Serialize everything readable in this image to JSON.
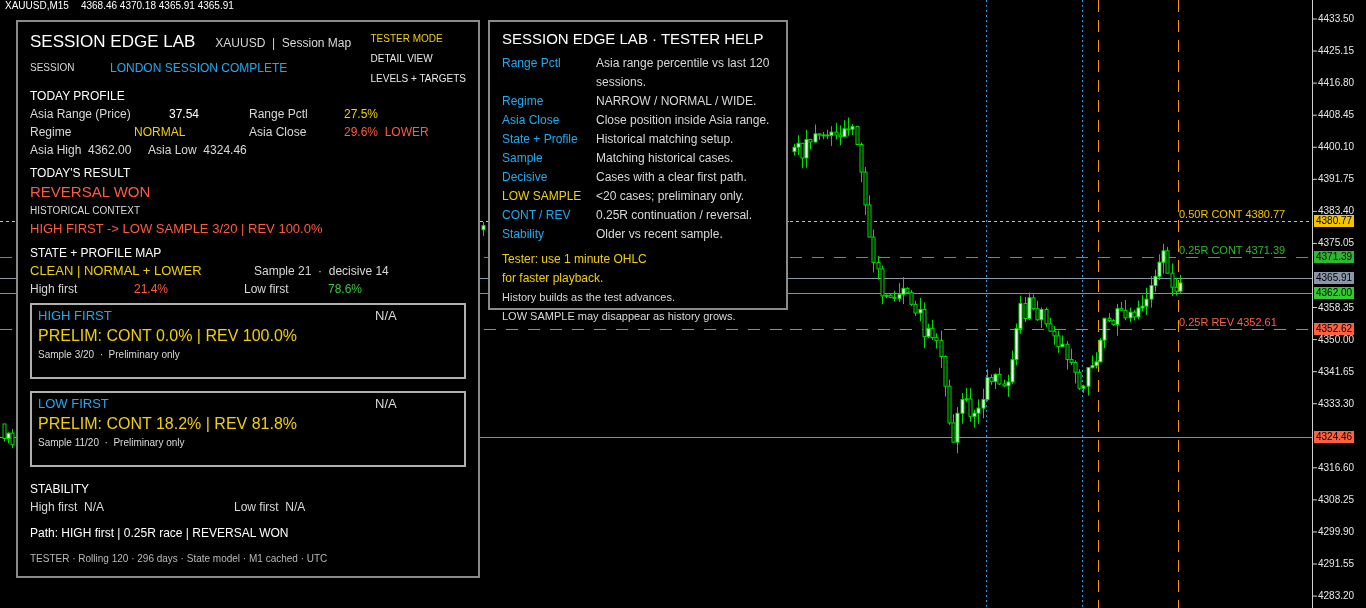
{
  "chart_header": {
    "symbol": "XAUUSD,M15",
    "ohlc": "4368.46 4370.18 4365.91 4365.91"
  },
  "dashboard": {
    "title": "SESSION EDGE LAB",
    "subtitle": "XAUUSD  |  Session Map",
    "modes": [
      {
        "label": "TESTER MODE",
        "selected": true
      },
      {
        "label": "DETAIL VIEW",
        "selected": false
      },
      {
        "label": "LEVELS + TARGETS",
        "selected": false
      }
    ],
    "session": {
      "label": "SESSION",
      "value": "LONDON SESSION COMPLETE"
    },
    "today_profile": {
      "heading": "TODAY PROFILE",
      "asia_range": {
        "label": "Asia Range (Price)",
        "value": "37.54"
      },
      "range_pctl": {
        "label": "Range Pctl",
        "value": "27.5%"
      },
      "regime": {
        "label": "Regime",
        "value": "NORMAL"
      },
      "asia_close": {
        "label": "Asia Close",
        "value": "29.6%  LOWER"
      },
      "asia_high": {
        "label": "Asia High",
        "value": "4362.00"
      },
      "asia_low": {
        "label": "Asia Low",
        "value": "4324.46"
      }
    },
    "result": {
      "heading": "TODAY'S RESULT",
      "outcome": "REVERSAL WON",
      "context_label": "HISTORICAL CONTEXT",
      "context": "HIGH FIRST -> LOW SAMPLE 3/20 | REV 100.0%"
    },
    "state_map": {
      "heading": "STATE + PROFILE MAP",
      "state": "CLEAN | NORMAL + LOWER",
      "sample": "Sample 21  ·  decisive 14",
      "high_first": {
        "label": "High first",
        "value": "21.4%"
      },
      "low_first": {
        "label": "Low first",
        "value": "78.6%"
      }
    },
    "scenarios": [
      {
        "title": "HIGH FIRST",
        "status": "N/A",
        "result": "PRELIM: CONT 0.0% | REV 100.0%",
        "note": "Sample 3/20  ·  Preliminary only"
      },
      {
        "title": "LOW FIRST",
        "status": "N/A",
        "result": "PRELIM: CONT 18.2% | REV 81.8%",
        "note": "Sample 11/20  ·  Preliminary only"
      }
    ],
    "stability": {
      "heading": "STABILITY",
      "high_first": "High first  N/A",
      "low_first": "Low first  N/A"
    },
    "path": "Path: HIGH first | 0.25R race | REVERSAL WON",
    "footer": "TESTER · Rolling 120 · 296 days · State model · M1 cached · UTC"
  },
  "help_panel": {
    "title": "SESSION EDGE LAB · TESTER HELP",
    "entries": [
      {
        "term": "Range Pctl",
        "text": "Asia range percentile vs last 120 sessions.",
        "kind": "info"
      },
      {
        "term": "Regime",
        "text": "NARROW / NORMAL / WIDE.",
        "kind": "info"
      },
      {
        "term": "Asia Close",
        "text": "Close position inside Asia range.",
        "kind": "info"
      },
      {
        "term": "State + Profile",
        "text": "Historical matching setup.",
        "kind": "info"
      },
      {
        "term": "Sample",
        "text": "Matching historical cases.",
        "kind": "info"
      },
      {
        "term": "Decisive",
        "text": "Cases with a clear first path.",
        "kind": "info"
      },
      {
        "term": "LOW SAMPLE",
        "text": "<20 cases; preliminary only.",
        "kind": "warning"
      },
      {
        "term": "CONT / REV",
        "text": "0.25R continuation / reversal.",
        "kind": "info"
      },
      {
        "term": "Stability",
        "text": "Older vs recent sample.",
        "kind": "info"
      }
    ],
    "notes": [
      {
        "text": "Tester: use 1 minute OHLC",
        "kind": "warning"
      },
      {
        "text": "for faster playback.",
        "kind": "warning"
      },
      {
        "text": "History builds as the test advances.",
        "kind": "info"
      }
    ],
    "overflow_note": "LOW SAMPLE may disappear as history grows."
  },
  "chart": {
    "levels": [
      {
        "label": "0.50R CONT  4380.77",
        "tag": "4380.77",
        "color": "#f5c400",
        "kind": "dotted"
      },
      {
        "label": "0.25R CONT  4371.39",
        "tag": "4371.39",
        "color": "#2eb82e",
        "kind": "dashed"
      },
      {
        "tag": "4365.91",
        "color": "#8898a8",
        "kind": "solid"
      },
      {
        "tag": "4362.00",
        "color": "#33cc33",
        "kind": "solid"
      },
      {
        "label": "0.25R REV  4352.61",
        "tag": "4352.62",
        "color": "#ff6040",
        "kind": "dashed"
      },
      {
        "tag": "4324.46",
        "color": "#ff6040",
        "kind": "solid"
      }
    ],
    "price_axis": [
      "4433.50",
      "4425.15",
      "4416.80",
      "4408.45",
      "4400.10",
      "4391.75",
      "4383.40",
      "4375.05",
      "4358.35",
      "4350.00",
      "4341.65",
      "4333.30",
      "4316.60",
      "4308.25",
      "4299.90",
      "4291.55",
      "4283.20"
    ]
  }
}
